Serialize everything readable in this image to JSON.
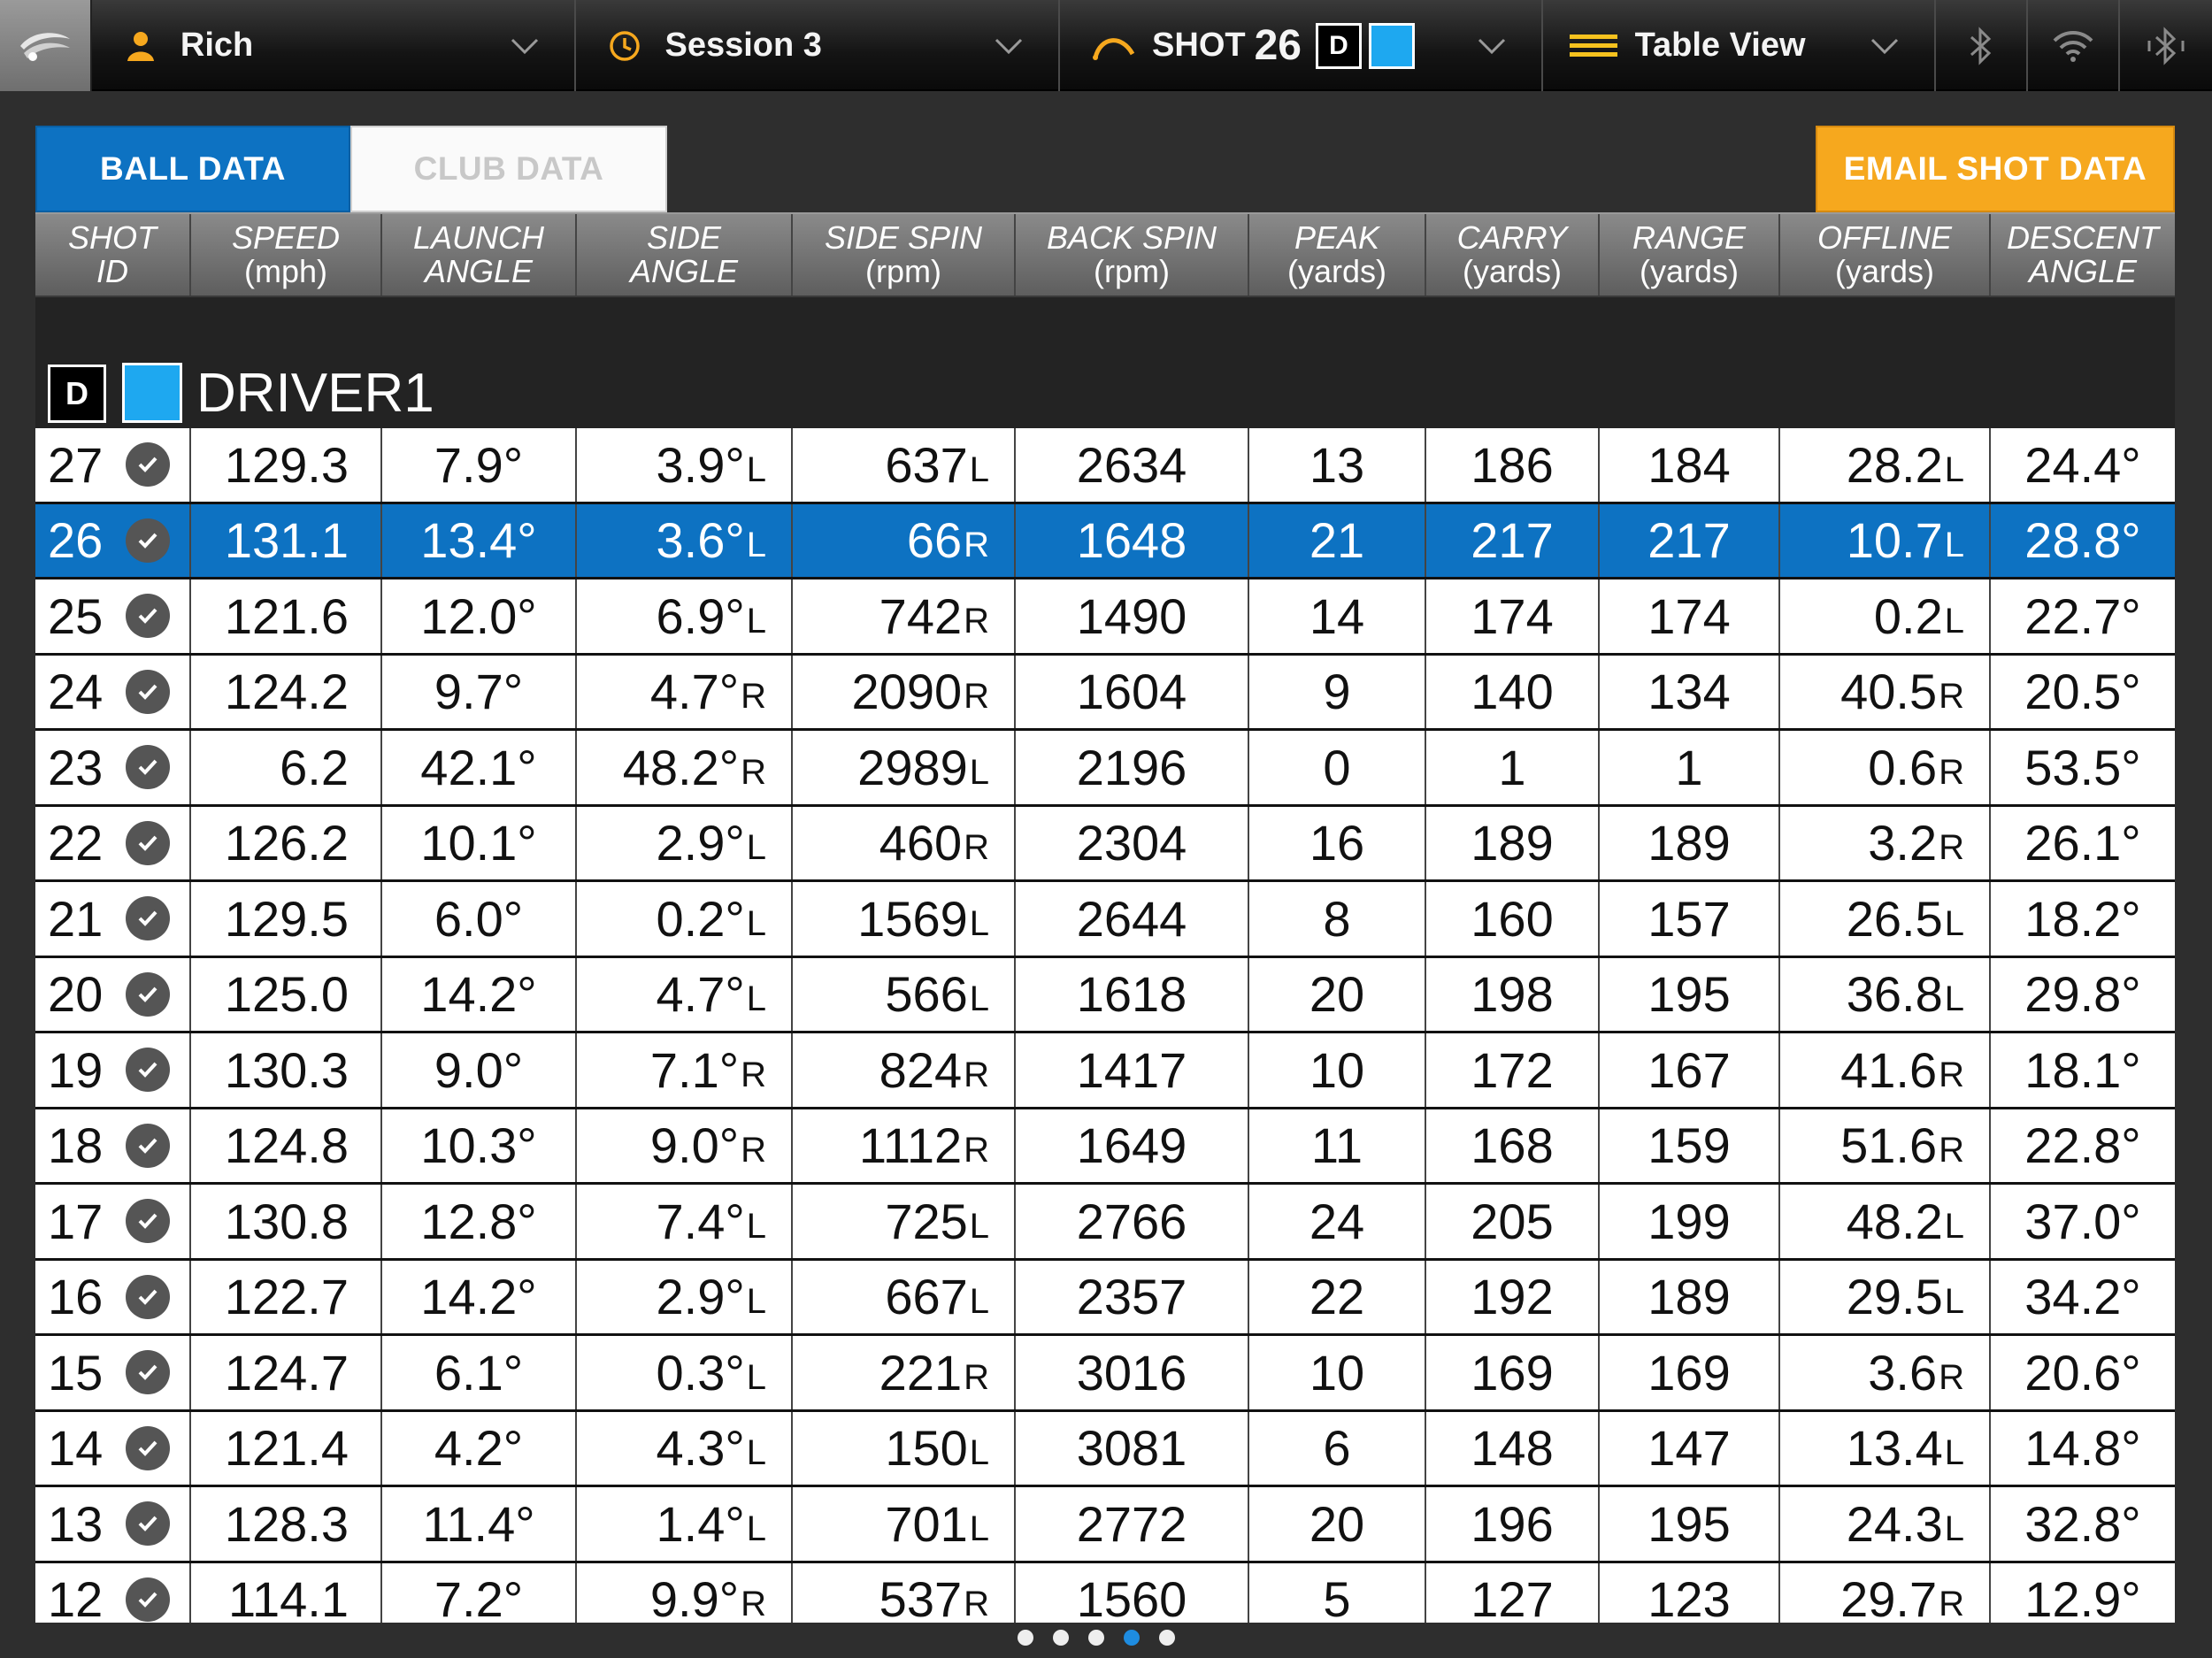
{
  "topbar": {
    "user": "Rich",
    "session": "Session 3",
    "shot_label": "SHOT",
    "shot_number": "26",
    "club_badge": "D",
    "club_color": "#1ea8f0",
    "view": "Table View",
    "icons": [
      "app-logo-icon",
      "user-icon",
      "clock-icon",
      "trajectory-icon",
      "list-icon",
      "bluetooth-icon",
      "wifi-icon",
      "bluetooth-off-icon"
    ]
  },
  "tabs": {
    "ball": "BALL DATA",
    "club": "CLUB DATA",
    "email": "EMAIL SHOT DATA"
  },
  "columns": [
    {
      "l1": "SHOT",
      "l2": "ID"
    },
    {
      "l1": "SPEED",
      "l2": "(mph)"
    },
    {
      "l1": "LAUNCH",
      "l2": "ANGLE"
    },
    {
      "l1": "SIDE",
      "l2": "ANGLE"
    },
    {
      "l1": "SIDE SPIN",
      "l2": "(rpm)"
    },
    {
      "l1": "BACK SPIN",
      "l2": "(rpm)"
    },
    {
      "l1": "PEAK",
      "l2": "(yards)"
    },
    {
      "l1": "CARRY",
      "l2": "(yards)"
    },
    {
      "l1": "RANGE",
      "l2": "(yards)"
    },
    {
      "l1": "OFFLINE",
      "l2": "(yards)"
    },
    {
      "l1": "DESCENT",
      "l2": "ANGLE"
    }
  ],
  "group": {
    "badge": "D",
    "name": "DRIVER1"
  },
  "selected_shot": "26",
  "rows": [
    {
      "id": "27",
      "speed": "129.3",
      "launch": "7.9°",
      "side": "3.9°",
      "side_dir": "L",
      "spin": "637",
      "spin_dir": "L",
      "back": "2634",
      "peak": "13",
      "carry": "186",
      "range": "184",
      "offline": "28.2",
      "off_dir": "L",
      "descent": "24.4°"
    },
    {
      "id": "26",
      "speed": "131.1",
      "launch": "13.4°",
      "side": "3.6°",
      "side_dir": "L",
      "spin": "66",
      "spin_dir": "R",
      "back": "1648",
      "peak": "21",
      "carry": "217",
      "range": "217",
      "offline": "10.7",
      "off_dir": "L",
      "descent": "28.8°"
    },
    {
      "id": "25",
      "speed": "121.6",
      "launch": "12.0°",
      "side": "6.9°",
      "side_dir": "L",
      "spin": "742",
      "spin_dir": "R",
      "back": "1490",
      "peak": "14",
      "carry": "174",
      "range": "174",
      "offline": "0.2",
      "off_dir": "L",
      "descent": "22.7°"
    },
    {
      "id": "24",
      "speed": "124.2",
      "launch": "9.7°",
      "side": "4.7°",
      "side_dir": "R",
      "spin": "2090",
      "spin_dir": "R",
      "back": "1604",
      "peak": "9",
      "carry": "140",
      "range": "134",
      "offline": "40.5",
      "off_dir": "R",
      "descent": "20.5°"
    },
    {
      "id": "23",
      "speed": "6.2",
      "launch": "42.1°",
      "side": "48.2°",
      "side_dir": "R",
      "spin": "2989",
      "spin_dir": "L",
      "back": "2196",
      "peak": "0",
      "carry": "1",
      "range": "1",
      "offline": "0.6",
      "off_dir": "R",
      "descent": "53.5°"
    },
    {
      "id": "22",
      "speed": "126.2",
      "launch": "10.1°",
      "side": "2.9°",
      "side_dir": "L",
      "spin": "460",
      "spin_dir": "R",
      "back": "2304",
      "peak": "16",
      "carry": "189",
      "range": "189",
      "offline": "3.2",
      "off_dir": "R",
      "descent": "26.1°"
    },
    {
      "id": "21",
      "speed": "129.5",
      "launch": "6.0°",
      "side": "0.2°",
      "side_dir": "L",
      "spin": "1569",
      "spin_dir": "L",
      "back": "2644",
      "peak": "8",
      "carry": "160",
      "range": "157",
      "offline": "26.5",
      "off_dir": "L",
      "descent": "18.2°"
    },
    {
      "id": "20",
      "speed": "125.0",
      "launch": "14.2°",
      "side": "4.7°",
      "side_dir": "L",
      "spin": "566",
      "spin_dir": "L",
      "back": "1618",
      "peak": "20",
      "carry": "198",
      "range": "195",
      "offline": "36.8",
      "off_dir": "L",
      "descent": "29.8°"
    },
    {
      "id": "19",
      "speed": "130.3",
      "launch": "9.0°",
      "side": "7.1°",
      "side_dir": "R",
      "spin": "824",
      "spin_dir": "R",
      "back": "1417",
      "peak": "10",
      "carry": "172",
      "range": "167",
      "offline": "41.6",
      "off_dir": "R",
      "descent": "18.1°"
    },
    {
      "id": "18",
      "speed": "124.8",
      "launch": "10.3°",
      "side": "9.0°",
      "side_dir": "R",
      "spin": "1112",
      "spin_dir": "R",
      "back": "1649",
      "peak": "11",
      "carry": "168",
      "range": "159",
      "offline": "51.6",
      "off_dir": "R",
      "descent": "22.8°"
    },
    {
      "id": "17",
      "speed": "130.8",
      "launch": "12.8°",
      "side": "7.4°",
      "side_dir": "L",
      "spin": "725",
      "spin_dir": "L",
      "back": "2766",
      "peak": "24",
      "carry": "205",
      "range": "199",
      "offline": "48.2",
      "off_dir": "L",
      "descent": "37.0°"
    },
    {
      "id": "16",
      "speed": "122.7",
      "launch": "14.2°",
      "side": "2.9°",
      "side_dir": "L",
      "spin": "667",
      "spin_dir": "L",
      "back": "2357",
      "peak": "22",
      "carry": "192",
      "range": "189",
      "offline": "29.5",
      "off_dir": "L",
      "descent": "34.2°"
    },
    {
      "id": "15",
      "speed": "124.7",
      "launch": "6.1°",
      "side": "0.3°",
      "side_dir": "L",
      "spin": "221",
      "spin_dir": "R",
      "back": "3016",
      "peak": "10",
      "carry": "169",
      "range": "169",
      "offline": "3.6",
      "off_dir": "R",
      "descent": "20.6°"
    },
    {
      "id": "14",
      "speed": "121.4",
      "launch": "4.2°",
      "side": "4.3°",
      "side_dir": "L",
      "spin": "150",
      "spin_dir": "L",
      "back": "3081",
      "peak": "6",
      "carry": "148",
      "range": "147",
      "offline": "13.4",
      "off_dir": "L",
      "descent": "14.8°"
    },
    {
      "id": "13",
      "speed": "128.3",
      "launch": "11.4°",
      "side": "1.4°",
      "side_dir": "L",
      "spin": "701",
      "spin_dir": "L",
      "back": "2772",
      "peak": "20",
      "carry": "196",
      "range": "195",
      "offline": "24.3",
      "off_dir": "L",
      "descent": "32.8°"
    },
    {
      "id": "12",
      "speed": "114.1",
      "launch": "7.2°",
      "side": "9.9°",
      "side_dir": "R",
      "spin": "537",
      "spin_dir": "R",
      "back": "1560",
      "peak": "5",
      "carry": "127",
      "range": "123",
      "offline": "29.7",
      "off_dir": "R",
      "descent": "12.9°"
    }
  ],
  "pagination": {
    "pages": 5,
    "active": 4
  },
  "colors": {
    "accent": "#0d72c2",
    "email": "#f6a81e",
    "club": "#1ea8f0"
  }
}
